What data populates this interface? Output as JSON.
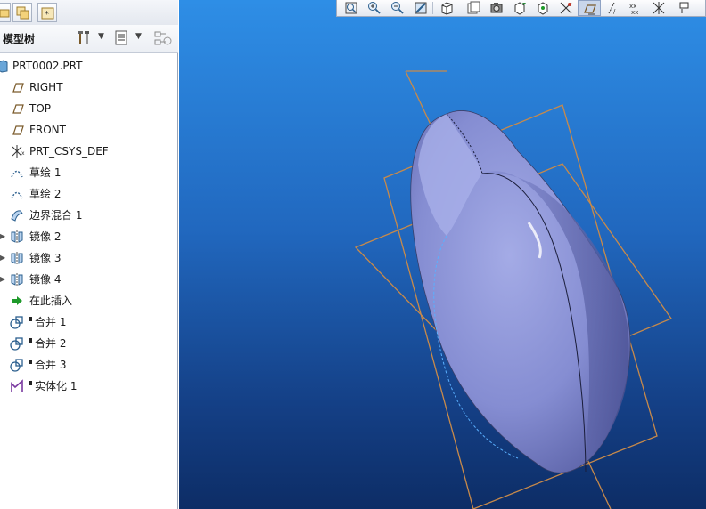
{
  "model_tree": {
    "title": "模型树",
    "items": [
      {
        "label": "PRT0002.PRT",
        "icon": "part-icon",
        "expandable": false
      },
      {
        "label": "RIGHT",
        "icon": "datum-plane-icon",
        "expandable": false
      },
      {
        "label": "TOP",
        "icon": "datum-plane-icon",
        "expandable": false
      },
      {
        "label": "FRONT",
        "icon": "datum-plane-icon",
        "expandable": false
      },
      {
        "label": "PRT_CSYS_DEF",
        "icon": "csys-icon",
        "expandable": false
      },
      {
        "label": "草绘 1",
        "icon": "sketch-icon",
        "expandable": false
      },
      {
        "label": "草绘 2",
        "icon": "sketch-icon",
        "expandable": false
      },
      {
        "label": "边界混合 1",
        "icon": "boundary-blend-icon",
        "expandable": false
      },
      {
        "label": "镜像 2",
        "icon": "mirror-icon",
        "expandable": true
      },
      {
        "label": "镜像 3",
        "icon": "mirror-icon",
        "expandable": true
      },
      {
        "label": "镜像 4",
        "icon": "mirror-icon",
        "expandable": true
      },
      {
        "label": "在此插入",
        "icon": "insert-here-arrow-icon",
        "expandable": false
      },
      {
        "label": "合并 1",
        "icon": "merge-icon",
        "expandable": false
      },
      {
        "label": "合并 2",
        "icon": "merge-icon",
        "expandable": false
      },
      {
        "label": "合并 3",
        "icon": "merge-icon",
        "expandable": false
      },
      {
        "label": "实体化 1",
        "icon": "solidify-icon",
        "expandable": false
      }
    ]
  },
  "viewport_toolbar": {
    "buttons": [
      "refit-icon",
      "zoom-in-icon",
      "zoom-out-icon",
      "repaint-icon",
      "display-style-icon",
      "saved-views-icon",
      "view-manager-icon",
      "perspective-icon",
      "spin-center-icon",
      "datum-display-icon",
      "plane-display-icon",
      "axis-display-icon",
      "point-display-icon",
      "csys-display-icon"
    ],
    "active": "plane-display-icon"
  },
  "colors": {
    "viewport_top": "#2e8ee6",
    "viewport_bottom": "#0d2d66",
    "model_fill": "#8e96d8",
    "datum_plane": "#c88a4a"
  }
}
